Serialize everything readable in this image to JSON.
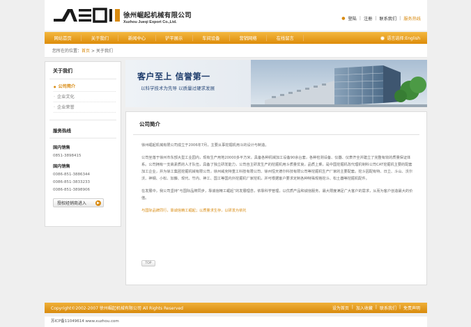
{
  "header": {
    "company_zh": "徐州崛起机械有限公司",
    "company_en": "Xuzhou Jueqi Export Co.,Ltd.",
    "links": {
      "login": "登陆",
      "register": "注册",
      "contact": "联系我们",
      "hotline": "服务热线"
    }
  },
  "nav": {
    "items": [
      "网站首页",
      "关于我们",
      "新闻中心",
      "铲平展示",
      "车间设备",
      "营销网络",
      "在线留言"
    ],
    "language": "语言选择:English"
  },
  "breadcrumb": {
    "prefix": "您所在的位置：",
    "home": "首页",
    "sep": " > ",
    "current": "关于我们"
  },
  "sidebar": {
    "title": "关于我们",
    "menu": [
      {
        "label": "公司简介",
        "active": true
      },
      {
        "label": "企业文化",
        "active": false
      },
      {
        "label": "企业荣誉",
        "active": false
      }
    ],
    "service_title": "服务热线",
    "groups": [
      {
        "label": "国内销售",
        "phones": [
          "0851-3898415"
        ]
      },
      {
        "label": "国内销售",
        "phones": [
          "0086-851-3886344",
          "0086-851-3833233",
          "0086-851-3898906"
        ]
      }
    ],
    "qq_button": "授权经销商进入"
  },
  "banner": {
    "title": "客户至上  信誉第一",
    "subtitle": "以科学技术为先导  以质量过硬求发展"
  },
  "content": {
    "title": "公司简介",
    "paragraphs": [
      "徐州崛起机械有限公司成立于2006年7月，主要从事挖掘机用斗的设计与制造。",
      "公司坐落于徐州市东部大型工业园内，现有生产用地20000多平方米，具备各种机械加工设备90余台套，各种检测设备、仪器、仪表齐全并建立了完整有效的质量保证体系。公司拥有一支高素质的人才队伍，具备了独立研发能力，公司自主研发生产的挖掘机用斗质量优良，品质上乘，是中国挖掘机改代理机制科公司CAT挖掘机主要的配套加工企业，并为徐工集团挖掘机械有限公司，徐州威克特重工科技有限公司、徐州恒天德尔科技有限公司等挖掘机生产厂家的主要配套。挖斗因配有特、日立、斗山、沃尔沃、神钢、小松、加藤、现代、竹内、神工、国工等国内外挖掘机厂家挖机，并可根据客户要求定制各种特殊规格挖斗、松土器等挖掘机配件。",
      "在发展中，我公司坚持“与国际品牌同步，靠诚信精工崛起”的发展理念，依靠科学管理，以优质产品和诚信服务，最大限度满足广大客户的需求，从而为客户创造最大的价值。"
    ],
    "slogan": "与国际品牌同行，靠诚信精工崛起；以质量求生存，以研发为依托",
    "pager": "TOP"
  },
  "footer": {
    "copyright": "Copyright©2002-2007 徐州崛起机械有限公司 All Rights Reserved",
    "links": [
      "设为首页",
      "加入收藏",
      "联系我们",
      "免责声明"
    ],
    "icp": "苏ICP备11049614  www.xuzhou.com"
  }
}
